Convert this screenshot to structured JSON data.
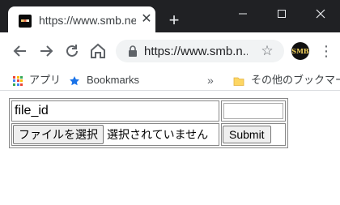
{
  "browser": {
    "tab": {
      "title": "https://www.smb.net/",
      "close": "✕"
    },
    "new_tab": "+",
    "omnibox": {
      "url": "https://www.smb.n..."
    },
    "extension_label": "SMB",
    "bookmarks": {
      "apps": "アプリ",
      "bookmarks": "Bookmarks",
      "overflow": "»",
      "other": "その他のブックマーク"
    }
  },
  "form": {
    "field_label": "file_id",
    "text_input_value": "",
    "file_button_label": "ファイルを選択",
    "file_status": "選択されていません",
    "submit_label": "Submit"
  }
}
